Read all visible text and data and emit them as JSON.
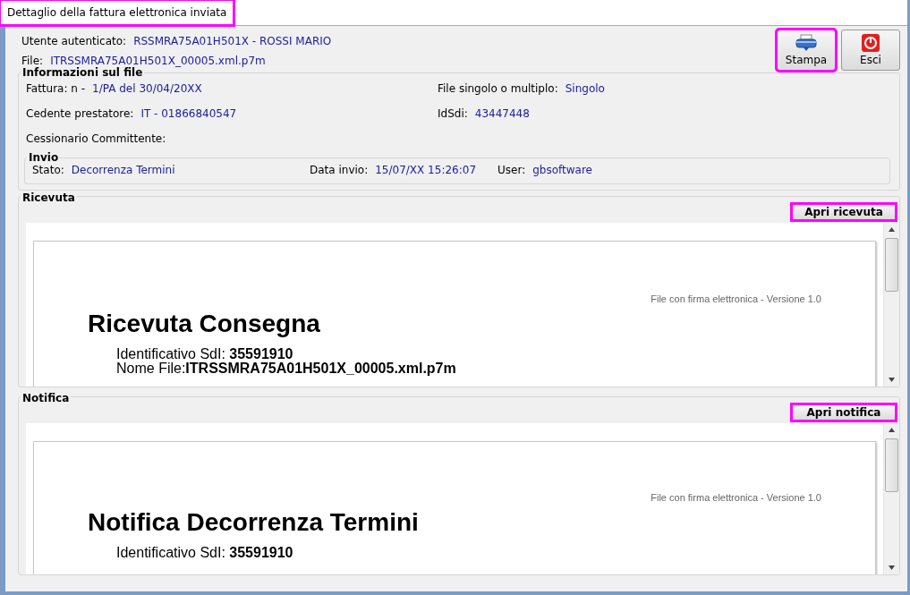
{
  "window": {
    "title": "Dettaglio della fattura elettronica inviata",
    "highlighted": true
  },
  "header": {
    "user_label": "Utente autenticato:",
    "user_value": "RSSMRA75A01H501X - ROSSI MARIO",
    "file_label": "File:",
    "file_value": "ITRSSMRA75A01H501X_00005.xml.p7m"
  },
  "toolbar": [
    {
      "label": "Stampa",
      "kind": "print",
      "highlighted": true
    },
    {
      "label": "Esci",
      "kind": "exit",
      "highlighted": false
    }
  ],
  "file_info": {
    "title": "Informazioni sul file",
    "fields": [
      {
        "label": "Fattura: n -",
        "value": "1/PA del 30/04/20XX"
      },
      {
        "label": "File singolo o multiplo:",
        "value": "Singolo"
      },
      {
        "label": "Cedente prestatore:",
        "value": "IT - 01866840547"
      },
      {
        "label": "IdSdi:",
        "value": "43447448"
      },
      {
        "label": "Cessionario Committente:"
      }
    ]
  },
  "invio": {
    "title": "Invio",
    "fields": [
      {
        "label": "Stato:",
        "value": "Decorrenza Termini"
      },
      {
        "label": "Data invio:",
        "value": "15/07/XX 15:26:07"
      },
      {
        "label": "User:",
        "value": "gbsoftware"
      }
    ]
  },
  "documents": [
    {
      "title": "Ricevuta",
      "button": "Apri ricevuta",
      "highlighted": true,
      "note": "File con firma elettronica - Versione 1.0",
      "heading": "Ricevuta Consegna",
      "lines": [
        "Identificativo SdI: **35591910**",
        "Nome File:**ITRSSMRA75A01H501X_00005.xml.p7m**"
      ]
    },
    {
      "title": "Notifica",
      "button": "Apri notifica",
      "highlighted": true,
      "note": "File con firma elettronica - Versione 1.0",
      "heading": "Notifica Decorrenza Termini",
      "lines": [
        "Identificativo SdI: **35591910**"
      ]
    }
  ]
}
